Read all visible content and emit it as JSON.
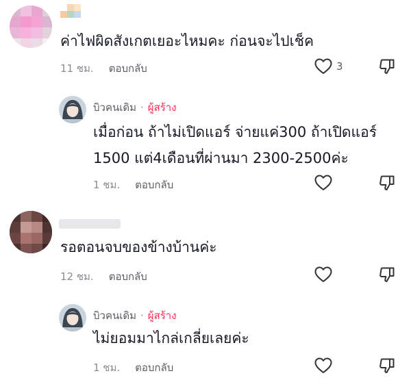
{
  "comments": [
    {
      "text": "ค่าไฟผิดสังเกตเยอะไหมคะ ก่อนจะไปเช็ค",
      "time": "11 ชม.",
      "reply_label": "ตอบกลับ",
      "like_count": "3",
      "reply": {
        "author": "บิวคนเดิม",
        "separator": "·",
        "author_badge": "ผู้สร้าง",
        "text_lines": [
          "เมื่อก่อน ถ้าไม่เปิดแอร์ จ่ายแค่300 ถ้าเปิดแอร์",
          "1500 แต่4เดือนที่ผ่านมา 2300-2500ค่ะ"
        ],
        "time": "1 ชม.",
        "reply_label": "ตอบกลับ"
      }
    },
    {
      "text": "รอตอนจบของข้างบ้านค่ะ",
      "time": "12 ชม.",
      "reply_label": "ตอบกลับ",
      "reply": {
        "author": "บิวคนเดิม",
        "separator": "·",
        "author_badge": "ผู้สร้าง",
        "text_lines": [
          "ไม่ยอมมาไกล่เกลี่ยเลยค่ะ"
        ],
        "time": "1 ชม.",
        "reply_label": "ตอบกลับ"
      }
    }
  ],
  "icons": {
    "like": "heart-outline-icon",
    "dislike": "thumbs-down-outline-icon"
  },
  "colors": {
    "creator_badge": "#fe2c55",
    "meta_text": "#8a8b91"
  }
}
